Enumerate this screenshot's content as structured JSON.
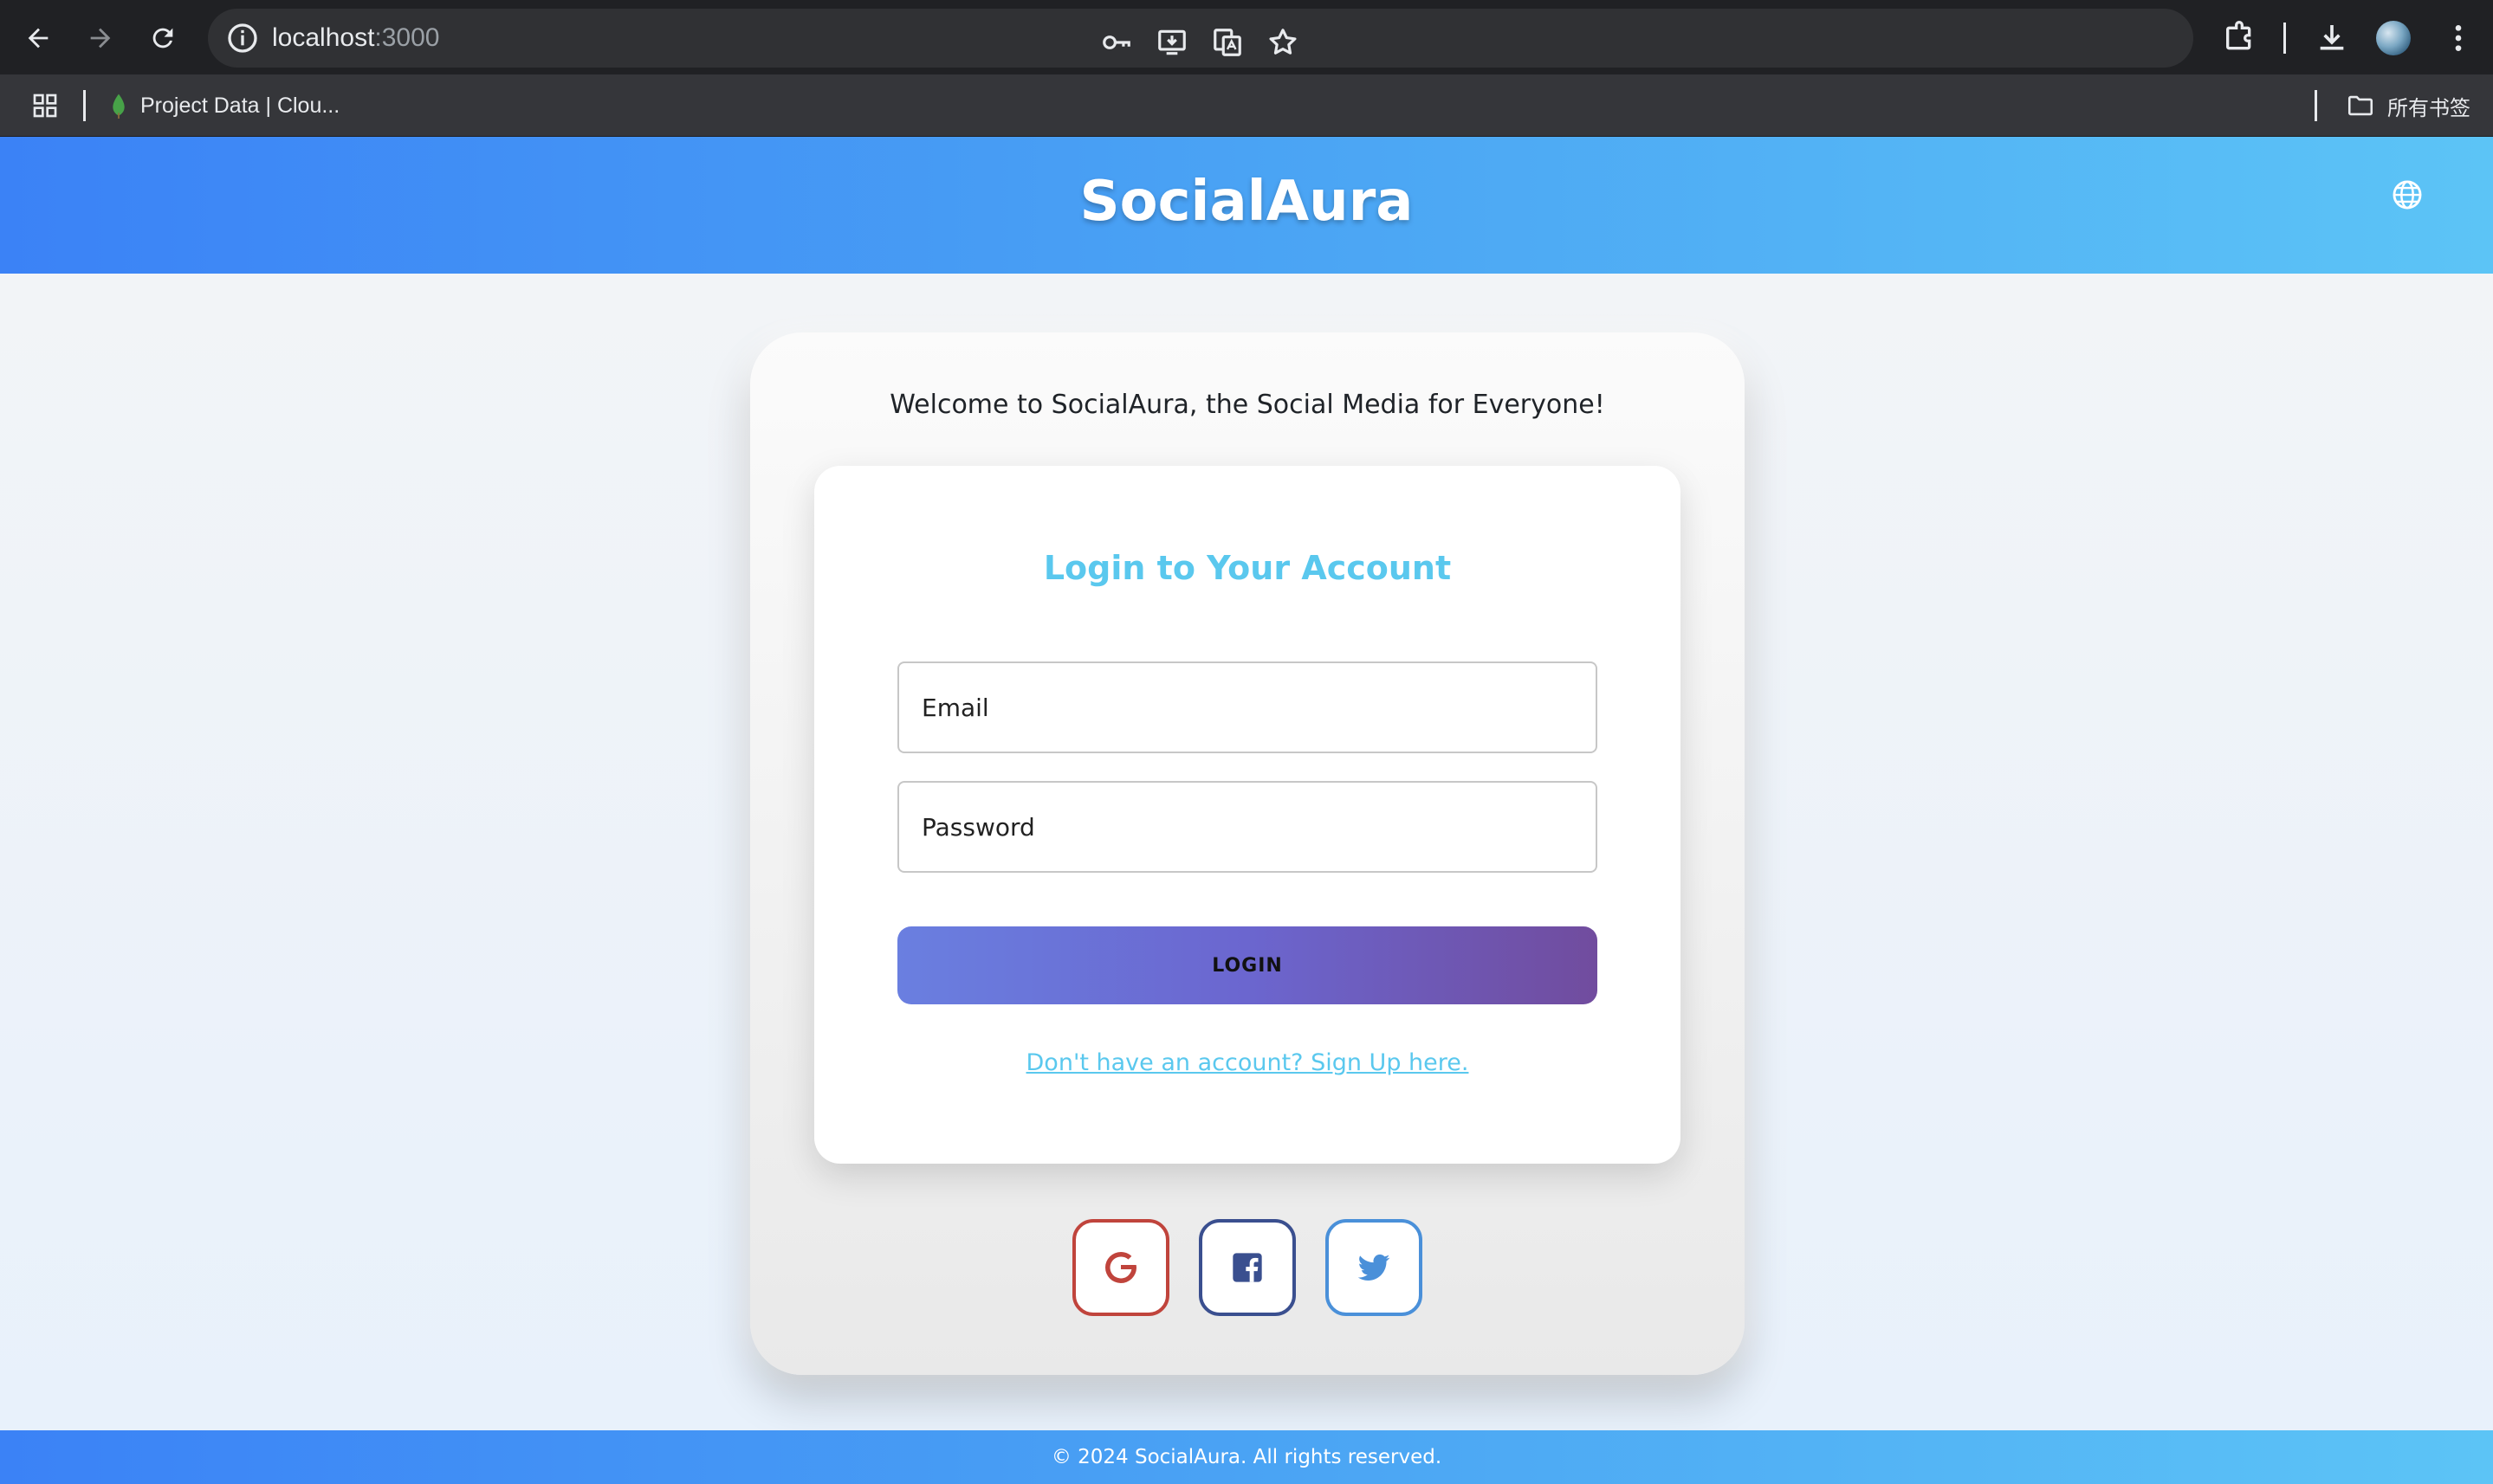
{
  "browser": {
    "url_host": "localhost",
    "url_port": ":3000",
    "bookmark_label": "Project Data | Clou...",
    "all_bookmarks_label": "所有书签"
  },
  "icons": {
    "back": "back-arrow-icon",
    "forward": "forward-arrow-icon",
    "reload": "reload-icon",
    "site_info": "info-icon",
    "password": "key-icon",
    "install": "install-app-icon",
    "translate": "translate-icon",
    "bookmark_star": "star-icon",
    "extensions": "puzzle-icon",
    "downloads": "download-icon",
    "menu": "kebab-menu-icon",
    "apps": "apps-grid-icon",
    "folder": "folder-icon",
    "language": "globe-icon",
    "google": "google-icon",
    "facebook": "facebook-icon",
    "twitter": "twitter-icon"
  },
  "header": {
    "title": "SocialAura"
  },
  "main": {
    "welcome": "Welcome to SocialAura, the Social Media for Everyone!",
    "login": {
      "title": "Login to Your Account",
      "email_placeholder": "Email",
      "password_placeholder": "Password",
      "button_label": "LOGIN",
      "signup_link": "Don't have an account? Sign Up here."
    }
  },
  "footer": {
    "text": "© 2024 SocialAura. All rights reserved."
  },
  "colors": {
    "header_gradient_start": "#3b82f6",
    "header_gradient_end": "#5cc4f6",
    "accent": "#5ac8ee",
    "button_gradient_start": "#6a7fe0",
    "button_gradient_end": "#714c9e",
    "google": "#c0443c",
    "facebook": "#3a4f8f",
    "twitter": "#4a90d9"
  }
}
